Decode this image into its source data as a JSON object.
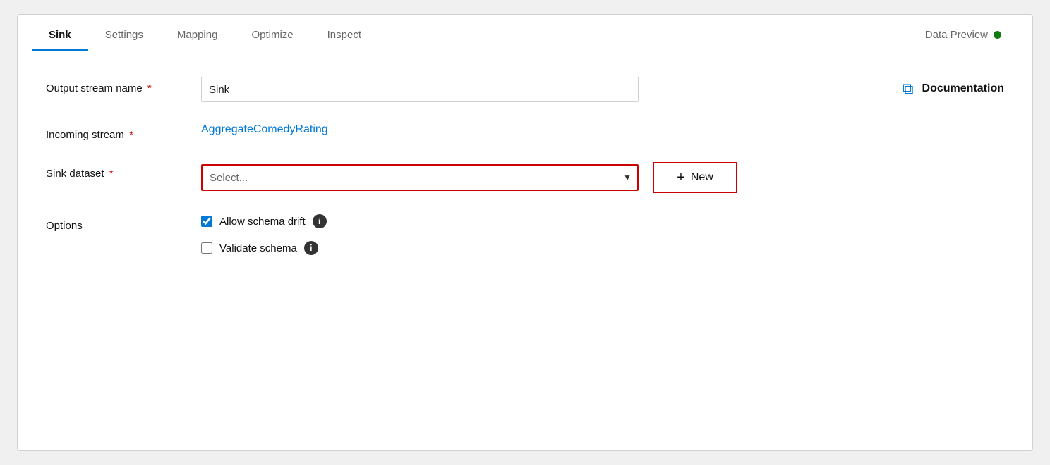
{
  "tabs": [
    {
      "id": "sink",
      "label": "Sink",
      "active": true
    },
    {
      "id": "settings",
      "label": "Settings",
      "active": false
    },
    {
      "id": "mapping",
      "label": "Mapping",
      "active": false
    },
    {
      "id": "optimize",
      "label": "Optimize",
      "active": false
    },
    {
      "id": "inspect",
      "label": "Inspect",
      "active": false
    },
    {
      "id": "data-preview",
      "label": "Data Preview",
      "active": false
    }
  ],
  "data_preview_dot_color": "#107c10",
  "form": {
    "output_stream_name": {
      "label": "Output stream name",
      "required": true,
      "value": "Sink",
      "placeholder": "Sink"
    },
    "incoming_stream": {
      "label": "Incoming stream",
      "required": true,
      "value": "AggregateComedyRating"
    },
    "sink_dataset": {
      "label": "Sink dataset",
      "required": true,
      "placeholder": "Select..."
    },
    "options": {
      "label": "Options",
      "checkboxes": [
        {
          "id": "allow-schema-drift",
          "label": "Allow schema drift",
          "checked": true
        },
        {
          "id": "validate-schema",
          "label": "Validate schema",
          "checked": false
        }
      ]
    }
  },
  "documentation": {
    "label": "Documentation",
    "icon": "⧉"
  },
  "new_button": {
    "label": "New",
    "plus": "+"
  }
}
